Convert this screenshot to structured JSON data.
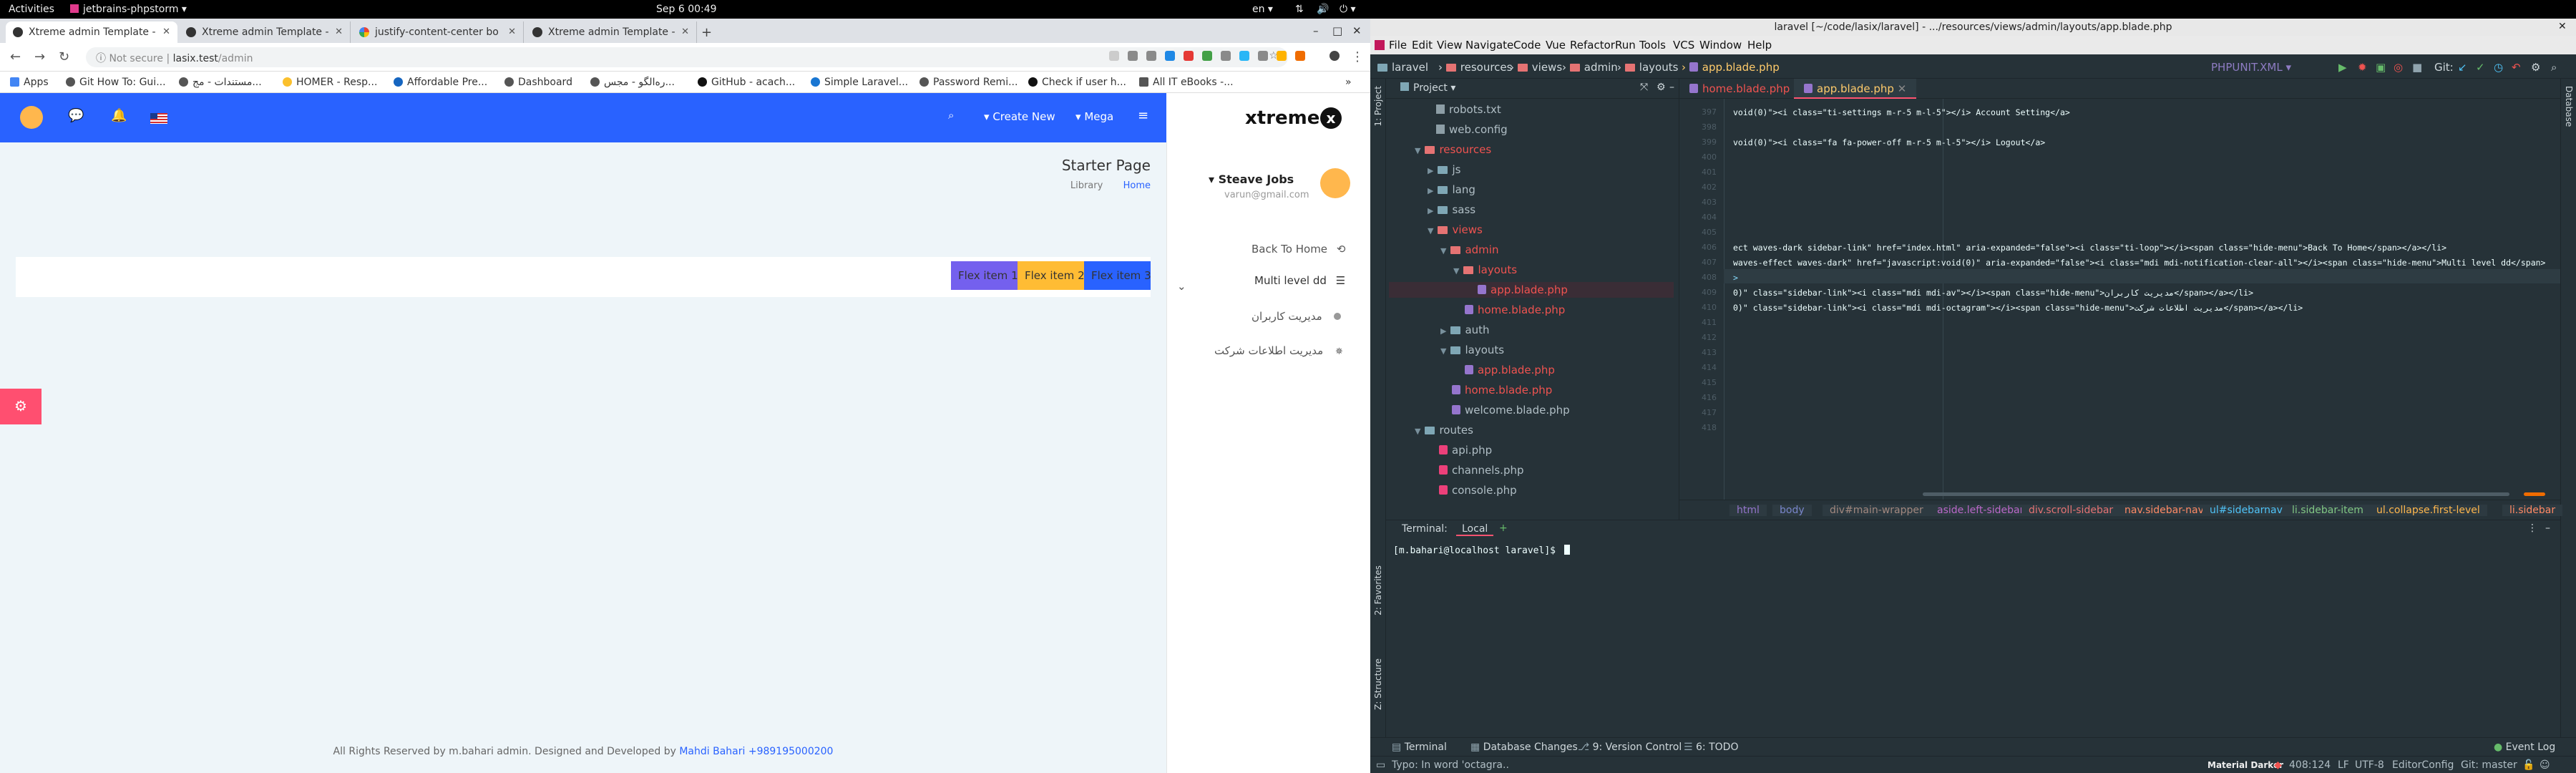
{
  "topbar": {
    "activities": "Activities",
    "app_menu": "jetbrains-phpstorm ▾",
    "clock": "Sep 6  00:49",
    "lang": "en ▾"
  },
  "chrome": {
    "tabs": [
      {
        "title": "Xtreme admin Template -"
      },
      {
        "title": "Xtreme admin Template -"
      },
      {
        "title": "justify-content-center bo"
      },
      {
        "title": "Xtreme admin Template -"
      }
    ],
    "security": "Not secure",
    "url_host": "lasix.test",
    "url_path": "/admin",
    "bookmarks": [
      "Apps",
      "Git How To: Gui...",
      "مستندات - مج...",
      "HOMER - Resp...",
      "Affordable Pre...",
      "Dashboard",
      "ره‌الگو - مجس...",
      "GitHub - acach...",
      "Simple Laravel...",
      "Password Remi...",
      "Check if user h...",
      "All IT eBooks -..."
    ]
  },
  "webapp": {
    "topnav": {
      "create_new": "Create New",
      "mega": "Mega"
    },
    "brand": "xtreme",
    "page_title": "Starter Page",
    "breadcrumb": {
      "library": "Library",
      "home": "Home"
    },
    "flex_items": [
      "Flex item 1",
      "Flex item 2",
      "Flex item 3"
    ],
    "colors": {
      "appbar": "#2962ff",
      "item1": "#7460ee",
      "item2": "#ffbc34",
      "item3": "#2962ff",
      "fab": "#ff4f70"
    },
    "user": {
      "name": "Steave Jobs",
      "email": "varun@gmail.com"
    },
    "sidebar": {
      "back_home": "Back To Home",
      "multi_level": "Multi level dd",
      "users": "مدیریت کاربران",
      "company": "مدیریت اطلاعات شرکت"
    },
    "footer": {
      "text": "All Rights Reserved by m.bahari admin. Designed and Developed by",
      "link": "Mahdi Bahari +989195000200"
    }
  },
  "ide": {
    "title": "laravel [~/code/lasix/laravel] - .../resources/views/admin/layouts/app.blade.php",
    "menu": [
      "File",
      "Edit",
      "View",
      "Navigate",
      "Code",
      "Vue",
      "Refactor",
      "Run",
      "Tools",
      "VCS",
      "Window",
      "Help"
    ],
    "breadcrumb": [
      "laravel",
      "resources",
      "views",
      "admin",
      "layouts",
      "app.blade.php"
    ],
    "run_config": "PHPUNIT.XML",
    "git_label": "Git:",
    "project_label": "Project ▾",
    "tree": [
      {
        "label": "robots.txt",
        "kind": "file"
      },
      {
        "label": "web.config",
        "kind": "file"
      },
      {
        "label": "resources",
        "kind": "folder-red"
      },
      {
        "label": "js",
        "kind": "folder"
      },
      {
        "label": "lang",
        "kind": "folder"
      },
      {
        "label": "sass",
        "kind": "folder"
      },
      {
        "label": "views",
        "kind": "folder-red"
      },
      {
        "label": "admin",
        "kind": "folder-red"
      },
      {
        "label": "layouts",
        "kind": "folder-red"
      },
      {
        "label": "app.blade.php",
        "kind": "php-red"
      },
      {
        "label": "home.blade.php",
        "kind": "php-red"
      },
      {
        "label": "auth",
        "kind": "folder"
      },
      {
        "label": "layouts",
        "kind": "folder"
      },
      {
        "label": "app.blade.php",
        "kind": "php-red"
      },
      {
        "label": "home.blade.php",
        "kind": "php-red"
      },
      {
        "label": "welcome.blade.php",
        "kind": "php"
      },
      {
        "label": "routes",
        "kind": "folder"
      },
      {
        "label": "api.php",
        "kind": "php"
      },
      {
        "label": "channels.php",
        "kind": "php"
      },
      {
        "label": "console.php",
        "kind": "php"
      }
    ],
    "editor_tabs": [
      "home.blade.php",
      "app.blade.php"
    ],
    "line_numbers": [
      "397",
      "398",
      "399",
      "400",
      "401",
      "402",
      "403",
      "404",
      "405",
      "406",
      "407",
      "408",
      "409",
      "410",
      "411",
      "412",
      "413",
      "414",
      "415",
      "416",
      "417",
      "418"
    ],
    "code": [
      "void(0)\"><i class=\"ti-settings m-r-5 m-l-5\"></i> Account Setting</a>",
      "void(0)\"><i class=\"fa fa-power-off m-r-5 m-l-5\"></i> Logout</a>",
      "ect waves-dark sidebar-link\" href=\"index.html\" aria-expanded=\"false\"><i class=\"ti-loop\"></i><span class=\"hide-menu\">Back To Home</span></a></li>",
      " waves-effect waves-dark\" href=\"javascript:void(0)\" aria-expanded=\"false\"><i class=\"mdi mdi-notification-clear-all\"></i><span class=\"hide-menu\">Multi level dd</span>",
      ">",
      "0)\" class=\"sidebar-link\"><i class=\"mdi mdi-av\"></i><span class=\"hide-menu\">مدیریت کاربران</span></a></li>",
      "0)\" class=\"sidebar-link\"><i class=\"mdi mdi-octagram\"></i><span class=\"hide-menu\">مدیریت اطلاعات شرکت</span></a></li>"
    ],
    "tag_crumbs": [
      "html",
      "body",
      "div#main-wrapper",
      "aside.left-sidebar",
      "div.scroll-sidebar",
      "nav.sidebar-nav",
      "ul#sidebarnav",
      "li.sidebar-item",
      "ul.collapse.first-level",
      "li.sidebar"
    ],
    "terminal": {
      "label": "Terminal:",
      "tab": "Local",
      "prompt": "[m.bahari@localhost laravel]$"
    },
    "toolwindows": [
      "Terminal",
      "Database Changes",
      "9: Version Control",
      "6: TODO",
      "Event Log"
    ],
    "side_tools": {
      "project": "1: Project",
      "favorites": "2: Favorites",
      "structure": "Z: Structure",
      "database": "Database"
    },
    "status": {
      "message": "Typo: In word 'octagra..",
      "theme": "Material Darker",
      "position": "408:124",
      "lf": "LF",
      "encoding": "UTF-8",
      "editorconfig": "EditorConfig",
      "git": "Git: master"
    }
  }
}
